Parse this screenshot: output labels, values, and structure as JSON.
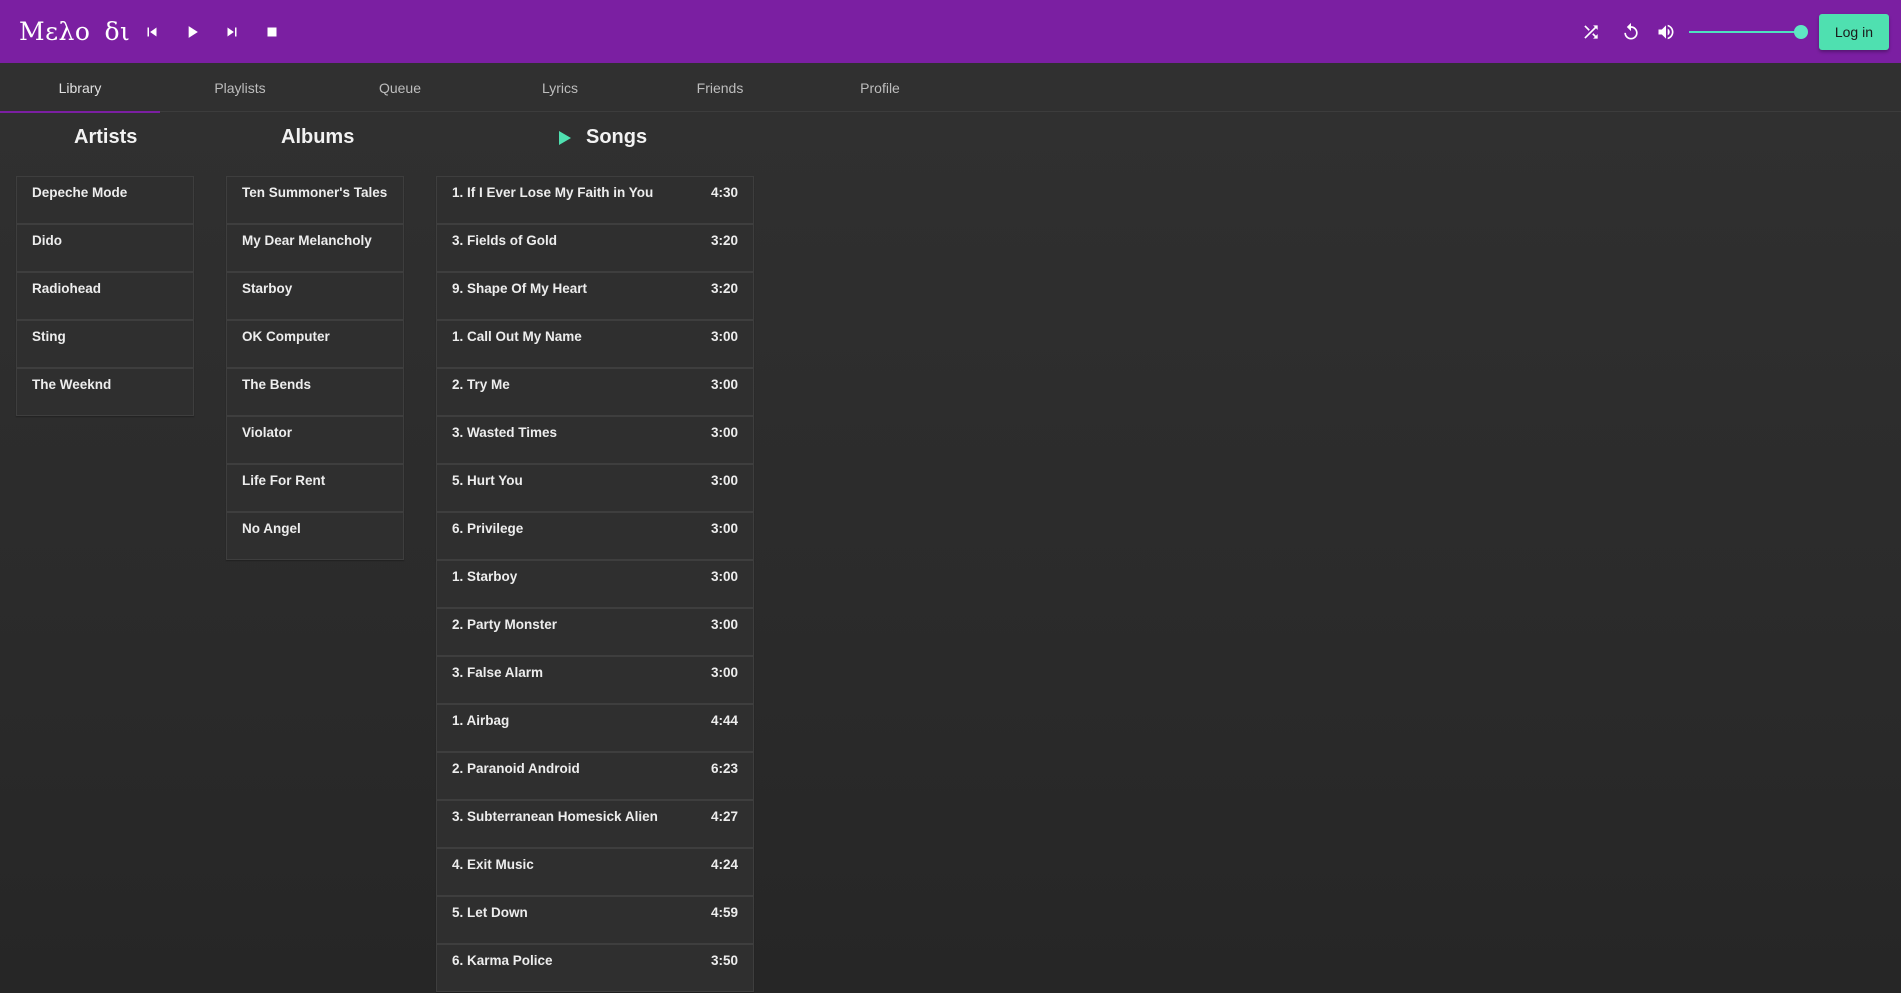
{
  "app": {
    "logo_left": "Μελο",
    "logo_right": "δι"
  },
  "player": {
    "prev_icon": "skip-previous-icon",
    "play_icon": "play-icon",
    "next_icon": "skip-next-icon",
    "stop_icon": "stop-icon",
    "shuffle_icon": "shuffle-icon",
    "repeat_icon": "repeat-icon",
    "volume_icon": "volume-icon",
    "volume_level": 1.0,
    "login_label": "Log in",
    "accent_color": "#4fe0b0",
    "bar_color": "#7b1fa2"
  },
  "tabs": [
    {
      "label": "Library",
      "active": true
    },
    {
      "label": "Playlists",
      "active": false
    },
    {
      "label": "Queue",
      "active": false
    },
    {
      "label": "Lyrics",
      "active": false
    },
    {
      "label": "Friends",
      "active": false
    },
    {
      "label": "Profile",
      "active": false
    }
  ],
  "library": {
    "artists_title": "Artists",
    "albums_title": "Albums",
    "songs_title": "Songs",
    "artists": [
      "Depeche Mode",
      "Dido",
      "Radiohead",
      "Sting",
      "The Weeknd"
    ],
    "albums": [
      "Ten Summoner's Tales",
      "My Dear Melancholy",
      "Starboy",
      "OK Computer",
      "The Bends",
      "Violator",
      "Life For Rent",
      "No Angel"
    ],
    "songs": [
      {
        "title": "1. If I Ever Lose My Faith in You",
        "duration": "4:30"
      },
      {
        "title": "3. Fields of Gold",
        "duration": "3:20"
      },
      {
        "title": "9. Shape Of My Heart",
        "duration": "3:20"
      },
      {
        "title": "1. Call Out My Name",
        "duration": "3:00"
      },
      {
        "title": "2. Try Me",
        "duration": "3:00"
      },
      {
        "title": "3. Wasted Times",
        "duration": "3:00"
      },
      {
        "title": "5. Hurt You",
        "duration": "3:00"
      },
      {
        "title": "6. Privilege",
        "duration": "3:00"
      },
      {
        "title": "1. Starboy",
        "duration": "3:00"
      },
      {
        "title": "2. Party Monster",
        "duration": "3:00"
      },
      {
        "title": "3. False Alarm",
        "duration": "3:00"
      },
      {
        "title": "1. Airbag",
        "duration": "4:44"
      },
      {
        "title": "2. Paranoid Android",
        "duration": "6:23"
      },
      {
        "title": "3. Subterranean Homesick Alien",
        "duration": "4:27"
      },
      {
        "title": "4. Exit Music",
        "duration": "4:24"
      },
      {
        "title": "5. Let Down",
        "duration": "4:59"
      },
      {
        "title": "6. Karma Police",
        "duration": "3:50"
      }
    ]
  }
}
